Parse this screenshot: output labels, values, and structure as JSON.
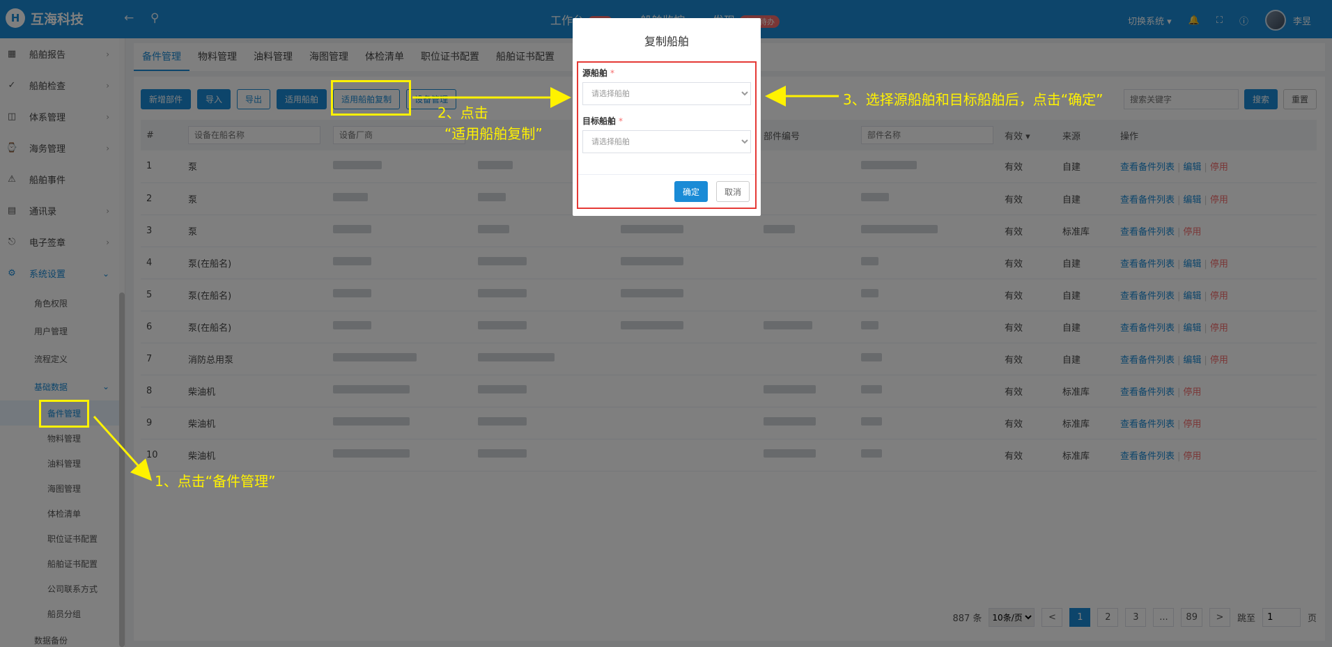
{
  "header": {
    "logo_mark": "H",
    "app_title": "互海科技",
    "nav": [
      {
        "label": "工作台",
        "badge": "549"
      },
      {
        "label": "船舶监控",
        "badge": ""
      },
      {
        "label": "发现",
        "badge": "今日待办"
      }
    ],
    "switch_system": "切换系统",
    "user_name": "李昱"
  },
  "sidebar": {
    "items": [
      {
        "label": "船舶报告",
        "icon": "report-icon"
      },
      {
        "label": "船舶检查",
        "icon": "check-icon"
      },
      {
        "label": "体系管理",
        "icon": "system-icon"
      },
      {
        "label": "海务管理",
        "icon": "marine-icon"
      },
      {
        "label": "船舶事件",
        "icon": "warning-icon"
      },
      {
        "label": "通讯录",
        "icon": "contacts-icon"
      },
      {
        "label": "电子签章",
        "icon": "stamp-icon"
      },
      {
        "label": "系统设置",
        "icon": "gear-icon"
      }
    ],
    "settings_sub": [
      "角色权限",
      "用户管理",
      "流程定义"
    ],
    "basic_data": "基础数据",
    "basic_data_items": [
      "备件管理",
      "物料管理",
      "油料管理",
      "海图管理",
      "体检清单",
      "职位证书配置",
      "船舶证书配置",
      "公司联系方式",
      "船员分组"
    ],
    "last_item": "数据备份"
  },
  "tabs": [
    "备件管理",
    "物料管理",
    "油料管理",
    "海图管理",
    "体检清单",
    "职位证书配置",
    "船舶证书配置"
  ],
  "toolbar": {
    "new_part": "新增部件",
    "import": "导入",
    "export": "导出",
    "apply_vessel": "适用船舶",
    "apply_vessel_copy": "适用船舶复制",
    "equipment_mgmt": "设备管理"
  },
  "search": {
    "placeholder": "搜索关键字",
    "search_btn": "搜索",
    "reset_btn": "重置"
  },
  "table": {
    "col_no": "#",
    "col_device_placeholder": "设备在船名称",
    "col_maker_placeholder": "设备厂商",
    "col_part_no": "部件编号",
    "col_part_name_placeholder": "部件名称",
    "col_valid": "有效",
    "col_source": "来源",
    "col_ops": "操作",
    "rows": [
      {
        "no": "1",
        "name": "泵",
        "valid": "有效",
        "source": "自建",
        "edit": true
      },
      {
        "no": "2",
        "name": "泵",
        "valid": "有效",
        "source": "自建",
        "edit": true
      },
      {
        "no": "3",
        "name": "泵",
        "valid": "有效",
        "source": "标准库",
        "edit": false
      },
      {
        "no": "4",
        "name": "泵(在船名)",
        "valid": "有效",
        "source": "自建",
        "edit": true
      },
      {
        "no": "5",
        "name": "泵(在船名)",
        "valid": "有效",
        "source": "自建",
        "edit": true
      },
      {
        "no": "6",
        "name": "泵(在船名)",
        "valid": "有效",
        "source": "自建",
        "edit": true
      },
      {
        "no": "7",
        "name": "消防总用泵",
        "valid": "有效",
        "source": "自建",
        "edit": true
      },
      {
        "no": "8",
        "name": "柴油机",
        "valid": "有效",
        "source": "标准库",
        "edit": false
      },
      {
        "no": "9",
        "name": "柴油机",
        "valid": "有效",
        "source": "标准库",
        "edit": false
      },
      {
        "no": "10",
        "name": "柴油机",
        "valid": "有效",
        "source": "标准库",
        "edit": false
      }
    ],
    "op_view": "查看备件列表",
    "op_edit": "编辑",
    "op_disable": "停用"
  },
  "pager": {
    "total": "887 条",
    "page_size": "10条/页",
    "prev": "<",
    "pages": [
      "1",
      "2",
      "3",
      "...",
      "89"
    ],
    "next": ">",
    "jump_label": "跳至",
    "jump_value": "1",
    "page_unit": "页"
  },
  "modal": {
    "title": "复制船舶",
    "source_label": "源船舶",
    "target_label": "目标船舶",
    "required_mark": "*",
    "select_placeholder": "请选择船舶",
    "ok": "确定",
    "cancel": "取消"
  },
  "annotations": {
    "step1": "1、点击“备件管理”",
    "step2_line1": "2、点击",
    "step2_line2": "“适用船舶复制”",
    "step3": "3、选择源船舶和目标船舶后，点击“确定”"
  },
  "colors": {
    "primary": "#1a8bd6",
    "danger": "#f56c6c",
    "annotation": "#fff200",
    "modal_border": "#e53935"
  }
}
